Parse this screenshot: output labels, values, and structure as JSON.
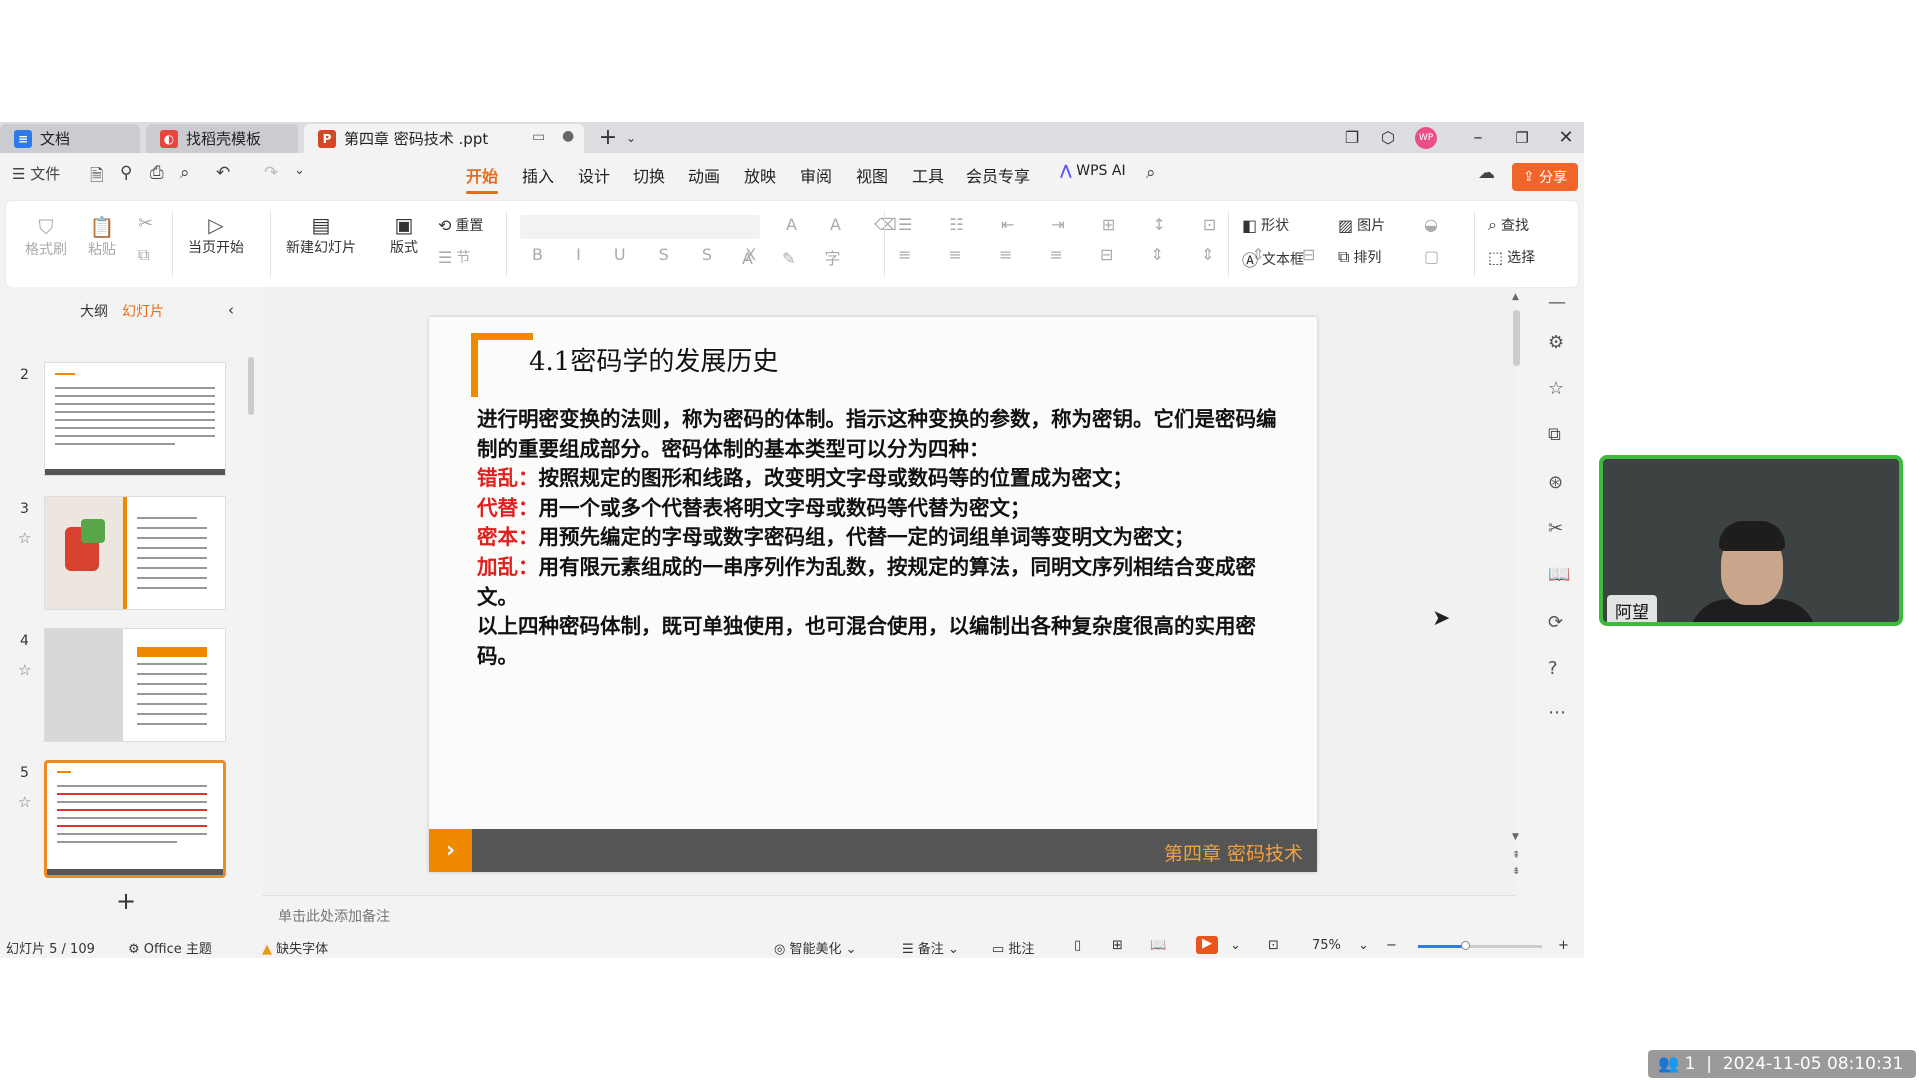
{
  "window": {
    "tabs": [
      {
        "label": "文档",
        "icon": "doc-icon"
      },
      {
        "label": "找稻壳模板",
        "icon": "docer-icon"
      },
      {
        "label": "第四章 密码技术 .ppt",
        "icon": "ppt-icon"
      }
    ],
    "avatar_text": "WP"
  },
  "menu": {
    "file": "文件",
    "tabs": [
      "开始",
      "插入",
      "设计",
      "切换",
      "动画",
      "放映",
      "审阅",
      "视图",
      "工具",
      "会员专享"
    ],
    "wps_ai": "WPS AI",
    "share": "分享"
  },
  "ribbon": {
    "format_painter": "格式刷",
    "paste": "粘贴",
    "play_from_current": "当页开始",
    "new_slide": "新建幻灯片",
    "layout": "版式",
    "reset": "重置",
    "section": "节",
    "shape": "形状",
    "picture": "图片",
    "find": "查找",
    "textbox": "文本框",
    "arrange": "排列",
    "select": "选择"
  },
  "left_panel": {
    "tab_outline": "大纲",
    "tab_slides": "幻灯片",
    "slides": [
      {
        "num": "2"
      },
      {
        "num": "3"
      },
      {
        "num": "4"
      },
      {
        "num": "5",
        "selected": true
      }
    ]
  },
  "slide": {
    "title": "4.1密码学的发展历史",
    "p1": "进行明密变换的法则，称为密码的体制。指示这种变换的参数，称为密钥。它们是密码编制的重要组成部分。密码体制的基本类型可以分为四种：",
    "items": [
      {
        "label": "错乱：",
        "text": "按照规定的图形和线路，改变明文字母或数码等的位置成为密文；"
      },
      {
        "label": "代替：",
        "text": "用一个或多个代替表将明文字母或数码等代替为密文；"
      },
      {
        "label": "密本：",
        "text": "用预先编定的字母或数字密码组，代替一定的词组单词等变明文为密文；"
      },
      {
        "label": "加乱：",
        "text": "用有限元素组成的一串序列作为乱数，按规定的算法，同明文序列相结合变成密文。"
      }
    ],
    "p_end": "以上四种密码体制，既可单独使用，也可混合使用，以编制出各种复杂度很高的实用密码。",
    "footer": "第四章 密码技术"
  },
  "notes_placeholder": "单击此处添加备注",
  "status": {
    "slide_count": "幻灯片 5 / 109",
    "theme": "Office 主题",
    "missing_font": "缺失字体",
    "smart_beautify": "智能美化",
    "notes": "备注",
    "comments": "批注",
    "zoom": "75%"
  },
  "video": {
    "name": "阿望"
  },
  "overlay": {
    "participants": "1",
    "timestamp": "2024-11-05 08:10:31"
  }
}
